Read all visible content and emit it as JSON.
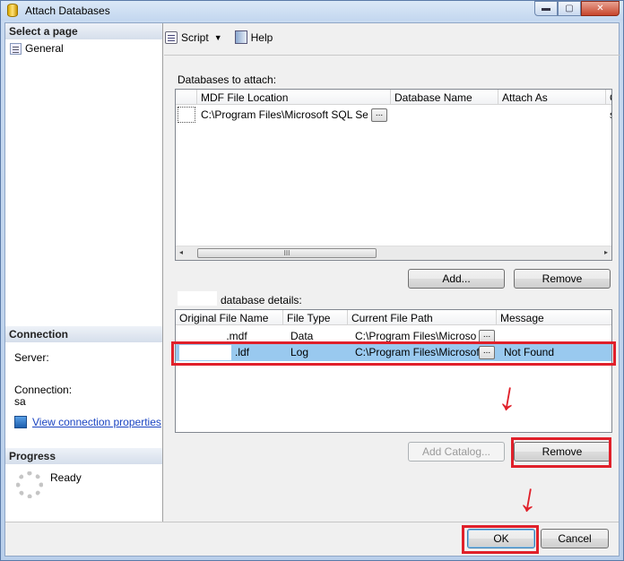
{
  "window": {
    "title": "Attach Databases",
    "caption_minimize": "▬",
    "caption_maximize": "▢",
    "caption_close": "✕"
  },
  "left": {
    "select_page_header": "Select a page",
    "pages": [
      {
        "label": "General",
        "icon": "page-icon"
      }
    ],
    "connection_header": "Connection",
    "server_label": "Server:",
    "connection_label": "Connection:",
    "connection_value": "sa",
    "view_props_link": "View connection properties",
    "progress_header": "Progress",
    "progress_status": "Ready"
  },
  "toolbar": {
    "script_label": "Script",
    "help_label": "Help",
    "dropdown_glyph": "▼"
  },
  "attach": {
    "label": "Databases to attach:",
    "columns": [
      "MDF File Location",
      "Database Name",
      "Attach As",
      "O"
    ],
    "rows": [
      {
        "mdf": "C:\\Program Files\\Microsoft SQL Ser...",
        "browse": "...",
        "database_name": "",
        "attach_as": "",
        "owner": "s"
      }
    ],
    "scroll_left": "◂",
    "scroll_right": "▸",
    "scroll_thumb": "III",
    "add_button": "Add...",
    "remove_button": "Remove"
  },
  "details": {
    "label": "database details:",
    "columns": [
      "Original File Name",
      "File Type",
      "Current File Path",
      "Message"
    ],
    "rows": [
      {
        "name": ".mdf",
        "type": "Data",
        "path": "C:\\Program Files\\Microso...",
        "browse": "...",
        "message": ""
      },
      {
        "name": ".ldf",
        "type": "Log",
        "path": "C:\\Program Files\\Microsoft S",
        "browse": "...",
        "message": "Not Found"
      }
    ],
    "add_catalog_button": "Add Catalog...",
    "remove_button": "Remove"
  },
  "footer": {
    "ok_button": "OK",
    "cancel_button": "Cancel"
  },
  "annotations": {
    "arrow_glyph": "↓",
    "highlight_color": "#e0202a"
  },
  "colors": {
    "selection": "#99c9ef",
    "link": "#1a44c2"
  }
}
